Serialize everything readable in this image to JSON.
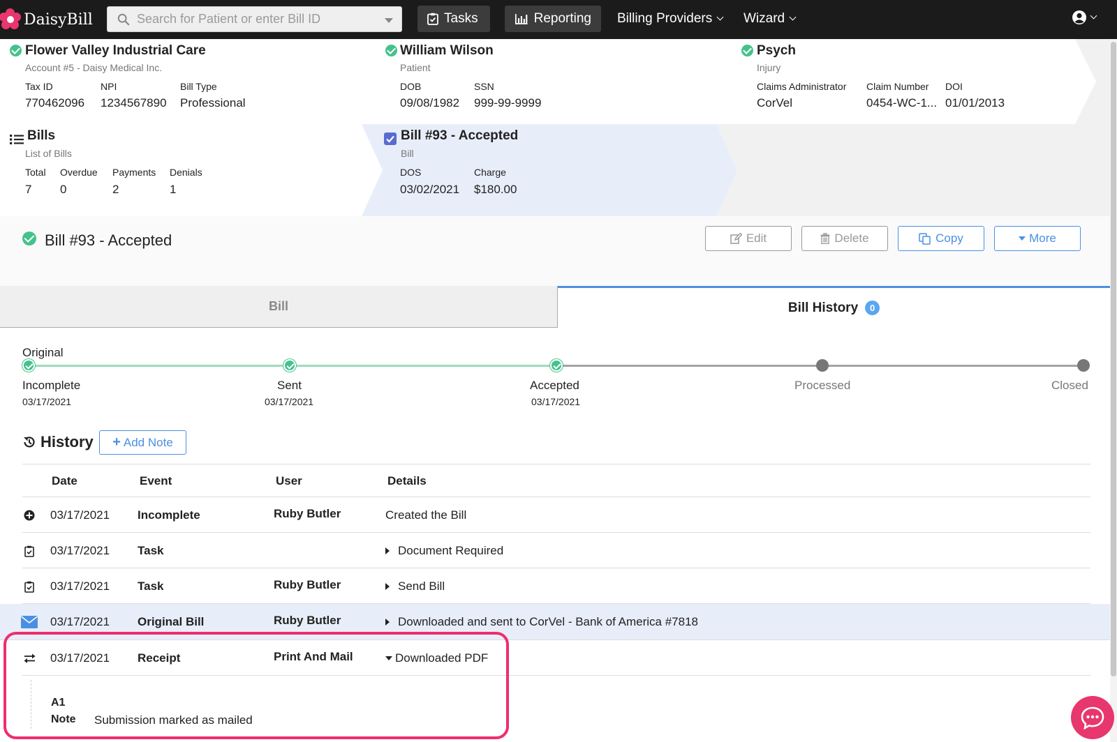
{
  "app": {
    "name": "DaisyBill"
  },
  "nav": {
    "search_placeholder": "Search for Patient or enter Bill ID",
    "tasks": "Tasks",
    "reporting": "Reporting",
    "billing_providers": "Billing Providers",
    "wizard": "Wizard"
  },
  "cards": {
    "provider": {
      "title": "Flower Valley Industrial Care",
      "subtitle": "Account #5 - Daisy Medical Inc.",
      "fields": [
        {
          "label": "Tax ID",
          "value": "770462096"
        },
        {
          "label": "NPI",
          "value": "1234567890"
        },
        {
          "label": "Bill Type",
          "value": "Professional"
        }
      ]
    },
    "patient": {
      "title": "William Wilson",
      "subtitle": "Patient",
      "fields": [
        {
          "label": "DOB",
          "value": "09/08/1982"
        },
        {
          "label": "SSN",
          "value": "999-99-9999"
        }
      ]
    },
    "injury": {
      "title": "Psych",
      "subtitle": "Injury",
      "fields": [
        {
          "label": "Claims Administrator",
          "value": "CorVel"
        },
        {
          "label": "Claim Number",
          "value": "0454-WC-1..."
        },
        {
          "label": "DOI",
          "value": "01/01/2013"
        }
      ]
    },
    "bills": {
      "title": "Bills",
      "subtitle": "List of Bills",
      "fields": [
        {
          "label": "Total",
          "value": "7"
        },
        {
          "label": "Overdue",
          "value": "0"
        },
        {
          "label": "Payments",
          "value": "2"
        },
        {
          "label": "Denials",
          "value": "1"
        }
      ]
    },
    "bill": {
      "title": "Bill #93 - Accepted",
      "subtitle": "Bill",
      "fields": [
        {
          "label": "DOS",
          "value": "03/02/2021"
        },
        {
          "label": "Charge",
          "value": "$180.00"
        }
      ]
    }
  },
  "header": {
    "title": "Bill #93 - Accepted",
    "edit": "Edit",
    "delete": "Delete",
    "copy": "Copy",
    "more": "More"
  },
  "tabs": {
    "bill": "Bill",
    "history": "Bill History",
    "history_badge": "0"
  },
  "tracker": {
    "label": "Original",
    "steps": [
      {
        "name": "Incomplete",
        "date": "03/17/2021"
      },
      {
        "name": "Sent",
        "date": "03/17/2021"
      },
      {
        "name": "Accepted",
        "date": "03/17/2021"
      },
      {
        "name": "Processed",
        "date": ""
      },
      {
        "name": "Closed",
        "date": ""
      }
    ]
  },
  "history": {
    "title": "History",
    "add_note": "Add Note",
    "columns": [
      "Date",
      "Event",
      "User",
      "Details"
    ],
    "rows": [
      {
        "date": "03/17/2021",
        "event": "Incomplete",
        "user": "Ruby Butler",
        "details": "Created the Bill"
      },
      {
        "date": "03/17/2021",
        "event": "Task",
        "user": "",
        "details": "Document Required"
      },
      {
        "date": "03/17/2021",
        "event": "Task",
        "user": "Ruby Butler",
        "details": "Send Bill"
      },
      {
        "date": "03/17/2021",
        "event": "Original Bill",
        "user": "Ruby Butler",
        "details": "Downloaded and sent to CorVel - Bank of America #7818"
      },
      {
        "date": "03/17/2021",
        "event": "Receipt",
        "user": "Print And Mail",
        "details": "Downloaded PDF"
      }
    ],
    "expanded": {
      "code": "A1",
      "note_label": "Note",
      "note_value": "Submission marked as mailed"
    }
  },
  "colors": {
    "accent_blue": "#4a90e2",
    "success_green": "#45c28c",
    "highlight_pink": "#ee2e6e",
    "nav_bg": "#1b1b1b"
  }
}
